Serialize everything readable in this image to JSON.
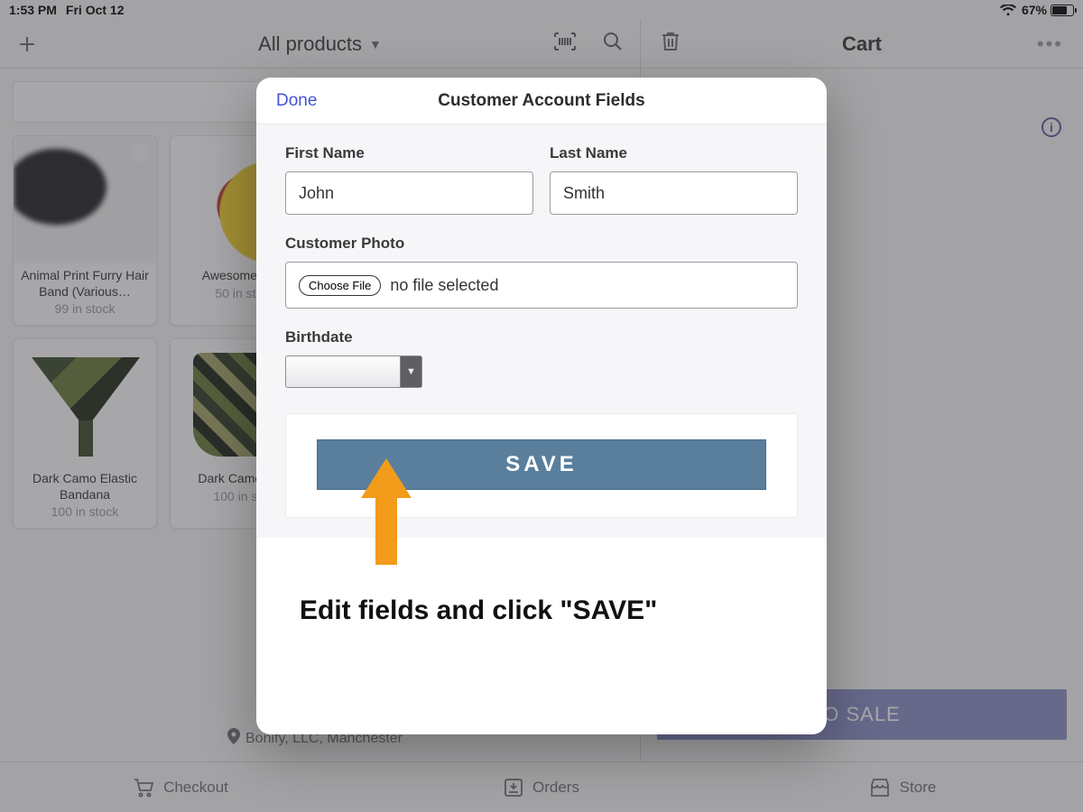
{
  "status": {
    "time": "1:53 PM",
    "date": "Fri Oct 12",
    "battery_pct": "67%"
  },
  "toolbar": {
    "products_label": "All products",
    "cart_label": "Cart"
  },
  "products": [
    {
      "title": "Animal Print Furry Hair Band (Various…",
      "stock": "99 in stock"
    },
    {
      "title": "Awesome S…",
      "stock": "50 in st…"
    },
    {
      "title": "Dark Camo Elastic Bandana",
      "stock": "100 in stock"
    },
    {
      "title": "Dark Camo Z…",
      "stock": "100 in s…"
    }
  ],
  "cart": {
    "add_to_sale": "O SALE"
  },
  "location": "Bonify, LLC, Manchester",
  "bottom": {
    "checkout": "Checkout",
    "orders": "Orders",
    "store": "Store"
  },
  "modal": {
    "done": "Done",
    "title": "Customer Account Fields",
    "first_name_label": "First Name",
    "first_name_value": "John",
    "last_name_label": "Last Name",
    "last_name_value": "Smith",
    "photo_label": "Customer Photo",
    "choose_file": "Choose File",
    "no_file": "no file selected",
    "birthdate_label": "Birthdate",
    "save": "SAVE"
  },
  "annotation": {
    "caption": "Edit fields and click \"SAVE\""
  }
}
